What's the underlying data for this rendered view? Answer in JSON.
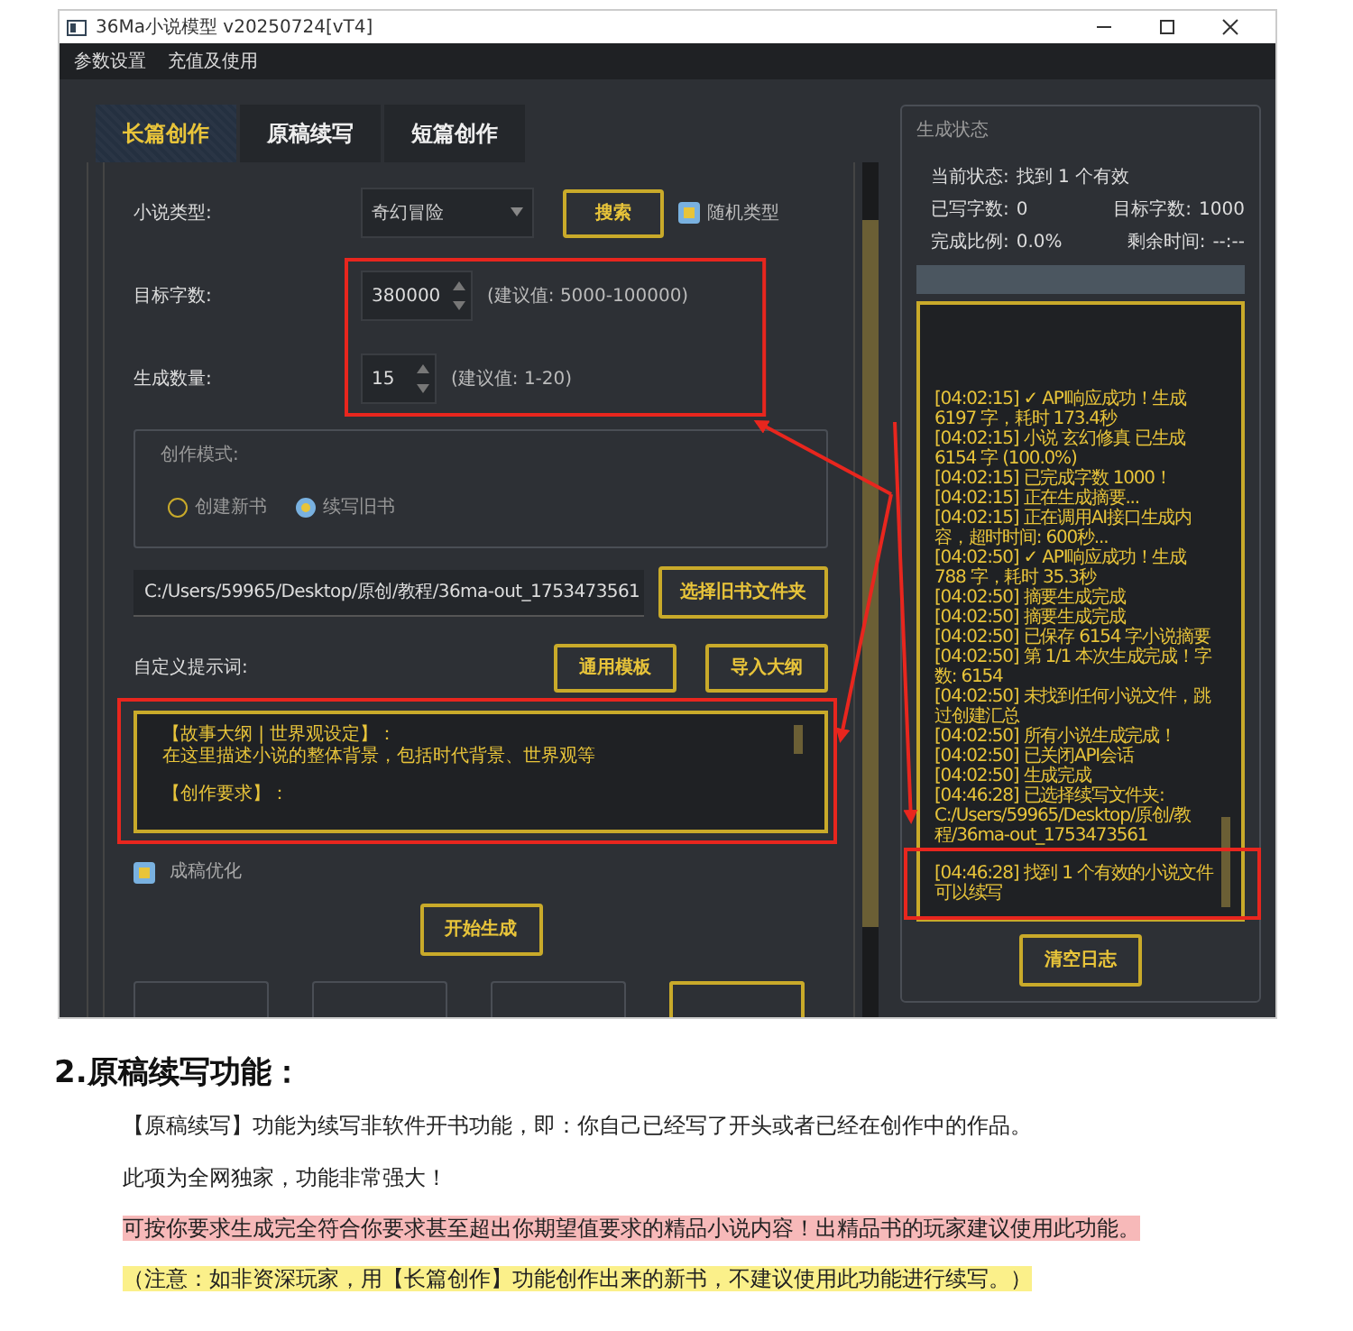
{
  "window": {
    "title": "36Ma小说模型 v20250724[vT4]"
  },
  "menu": [
    "参数设置",
    "充值及使用"
  ],
  "tabs": [
    {
      "label": "长篇创作",
      "selected": true
    },
    {
      "label": "原稿续写",
      "selected": false
    },
    {
      "label": "短篇创作",
      "selected": false
    }
  ],
  "form": {
    "genre_label": "小说类型:",
    "genre_value": "奇幻冒险",
    "search_button": "搜索",
    "random_checkbox": {
      "label": "随机类型",
      "checked": true
    },
    "target_label": "目标字数:",
    "target_value": "380000",
    "target_hint": "(建议值: 5000-100000)",
    "count_label": "生成数量:",
    "count_value": "15",
    "count_hint": "(建议值: 1-20)",
    "mode_group": {
      "title": "创作模式:",
      "options": [
        {
          "label": "创建新书",
          "selected": false
        },
        {
          "label": "续写旧书",
          "selected": true
        }
      ]
    },
    "path_value": "C:/Users/59965/Desktop/原创/教程/36ma-out_1753473561",
    "path_button": "选择旧书文件夹",
    "prompt_label": "自定义提示词:",
    "prompt_buttons": [
      "通用模板",
      "导入大纲"
    ],
    "prompt_sections": [
      [
        "【故事大纲 | 世界观设定】：",
        "在这里描述小说的整体背景，包括时代背景、世界观等"
      ],
      [
        "【创作要求】："
      ]
    ],
    "polish_checkbox": {
      "label": "成稿优化",
      "checked": true
    },
    "start_button": "开始生成"
  },
  "status": {
    "title": "生成状态",
    "current_label": "当前状态:",
    "current_value": "找到 1 个有效",
    "written_label": "已写字数:",
    "written_value": "0",
    "target_label": "目标字数:",
    "target_value": "1000",
    "ratio_label": "完成比例:",
    "ratio_value": "0.0%",
    "remaining_label": "剩余时间:",
    "remaining_value": "--:--",
    "progress": {
      "level": 0
    },
    "log": [
      "[04:02:15] ✓ API响应成功！生成 6197 字，耗时 173.4秒",
      "[04:02:15] 小说 玄幻修真 已生成 6154 字 (100.0%)",
      "[04:02:15] 已完成字数 1000！",
      "[04:02:15] 正在生成摘要...",
      "[04:02:15] 正在调用AI接口生成内容，超时时间: 600秒...",
      "[04:02:50] ✓ API响应成功！生成 788 字，耗时 35.3秒",
      "[04:02:50] 摘要生成完成",
      "[04:02:50] 摘要生成完成",
      "[04:02:50] 已保存 6154 字小说摘要",
      "[04:02:50] 第 1/1 本次生成完成！字数: 6154",
      "[04:02:50] 未找到任何小说文件，跳过创建汇总",
      "[04:02:50] 所有小说生成完成！",
      "[04:02:50] 已关闭API会话",
      "[04:02:50] 生成完成",
      "[04:46:28] 已选择续写文件夹: C:/Users/59965/Desktop/原创/教程/36ma-out_1753473561",
      "[04:46:28] 找到 1 个有效的小说文件可以续写"
    ],
    "clear_button": "清空日志"
  },
  "article": {
    "heading": "2.原稿续写功能：",
    "paragraphs": [
      {
        "text": "【原稿续写】功能为续写非软件开书功能，即：你自己已经写了开头或者已经在创作中的作品。"
      },
      {
        "text": "此项为全网独家，功能非常强大！"
      },
      {
        "text": "可按你要求生成完全符合你要求甚至超出你期望值要求的精品小说内容！出精品书的玩家建议使用此功能。",
        "color": "#f7b9b9"
      },
      {
        "text": "（注意：如非资深玩家，用【长篇创作】功能创作出来的新书，不建议使用此功能进行续写。）",
        "color": "#fbf08a"
      }
    ]
  }
}
